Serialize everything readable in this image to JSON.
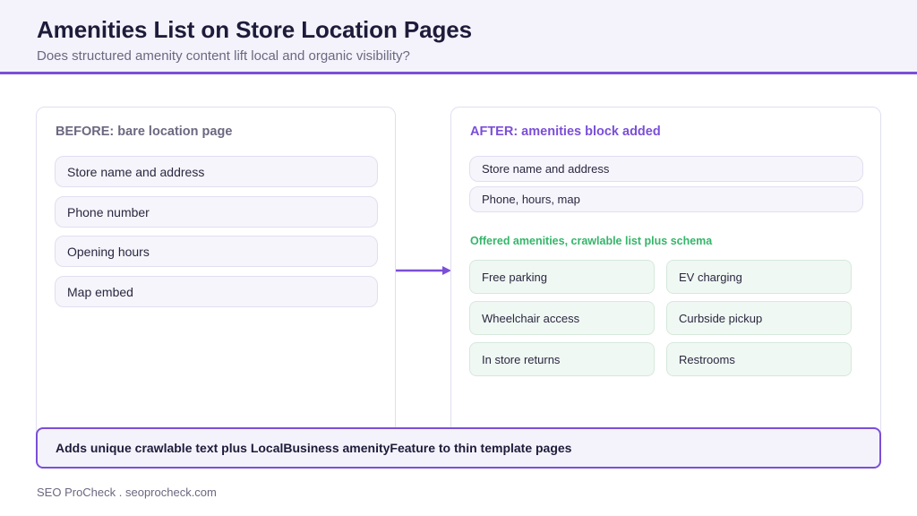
{
  "header": {
    "title": "Amenities List on Store Location Pages",
    "subtitle": "Does structured amenity content lift local and organic visibility?"
  },
  "before": {
    "title": "BEFORE: bare location page",
    "items": [
      "Store name and address",
      "Phone number",
      "Opening hours",
      "Map embed"
    ]
  },
  "after": {
    "title": "AFTER: amenities block added",
    "items": [
      "Store name and address",
      "Phone, hours, map"
    ],
    "amenities_title": "Offered amenities, crawlable list plus schema",
    "amenities": [
      "Free parking",
      "EV charging",
      "Wheelchair access",
      "Curbside pickup",
      "In store returns",
      "Restrooms"
    ]
  },
  "callout": "Adds unique crawlable text plus LocalBusiness amenityFeature to thin template pages",
  "footer": "SEO ProCheck . seoprocheck.com",
  "colors": {
    "accent": "#7b4fd8",
    "green": "#35b56a",
    "header_bg": "#f4f3fb"
  }
}
